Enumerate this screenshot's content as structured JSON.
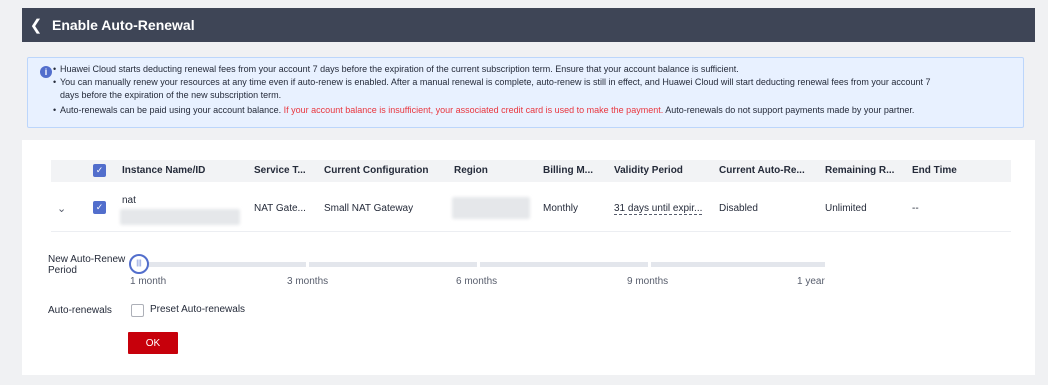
{
  "header": {
    "title": "Enable Auto-Renewal"
  },
  "notice": {
    "line1": "Huawei Cloud starts deducting renewal fees from your account 7 days before the expiration of the current subscription term. Ensure that your account balance is sufficient.",
    "line2": "You can manually renew your resources at any time even if auto-renew is enabled. After a manual renewal is complete, auto-renew is still in effect, and Huawei Cloud will start deducting renewal fees from your account 7",
    "line3": "days before the expiration of the new subscription term.",
    "line4_a": "Auto-renewals can be paid using your account balance.",
    "line4_red": "If your account balance is insufficient, your associated credit card is used to make the payment.",
    "line4_b": "Auto-renewals do not support payments made by your partner."
  },
  "table": {
    "columns": [
      "Instance Name/ID",
      "Service T...",
      "Current Configuration",
      "Region",
      "Billing M...",
      "Validity Period",
      "Current Auto-Re...",
      "Remaining R...",
      "End Time"
    ],
    "row": {
      "name": "nat",
      "service": "NAT Gate...",
      "configuration": "Small NAT Gateway",
      "billing": "Monthly",
      "validity": "31 days until expir...",
      "auto_renew": "Disabled",
      "remaining": "Unlimited",
      "end_time": "--"
    }
  },
  "period": {
    "label": "New Auto-Renew Period",
    "knob": "|||",
    "ticks": [
      "1 month",
      "3 months",
      "6 months",
      "9 months",
      "1 year"
    ]
  },
  "auto_renewals": {
    "label": "Auto-renewals",
    "preset_label": "Preset Auto-renewals"
  },
  "ok_label": "OK",
  "icons": {
    "back": "chevron-left-icon",
    "info": "info-icon",
    "expand": "chevron-down-icon",
    "check": "check-icon"
  },
  "colors": {
    "header_bg": "#3e4556",
    "accent": "#526ecc",
    "primary_button": "#c7000b",
    "warning_text": "#e9373f"
  }
}
